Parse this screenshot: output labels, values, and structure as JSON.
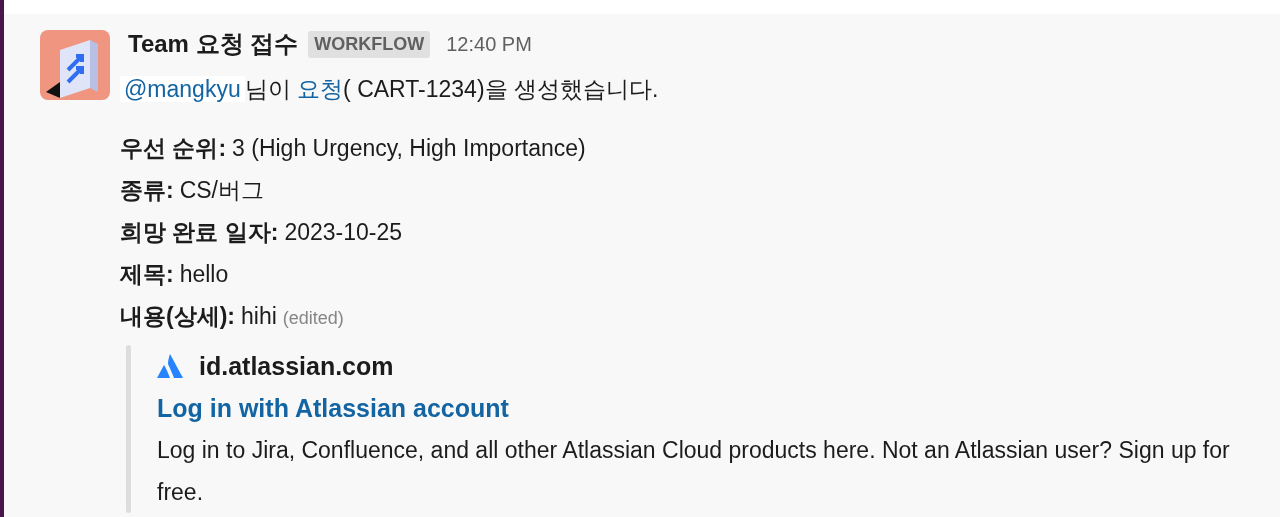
{
  "message": {
    "sender": "Team 요청 접수",
    "badge": "WORKFLOW",
    "time": "12:40 PM",
    "intro": {
      "mention": "@mangkyu",
      "text_1": "님이 ",
      "link": "요청",
      "text_2": "( CART-1234)을 생성했습니다."
    },
    "fields": [
      {
        "label": "우선 순위:",
        "value": "3 (High Urgency, High Importance)"
      },
      {
        "label": "종류:",
        "value": "CS/버그"
      },
      {
        "label": "희망 완료 일자:",
        "value": "2023-10-25"
      },
      {
        "label": "제목:",
        "value": "hello"
      },
      {
        "label": "내용(상세):",
        "value": "hihi",
        "edited": "(edited)"
      }
    ],
    "unfurl": {
      "site": "id.atlassian.com",
      "title": "Log in with Atlassian account",
      "description": "Log in to Jira, Confluence, and all other Atlassian Cloud products here. Not an Atlassian user? Sign up for free."
    }
  }
}
